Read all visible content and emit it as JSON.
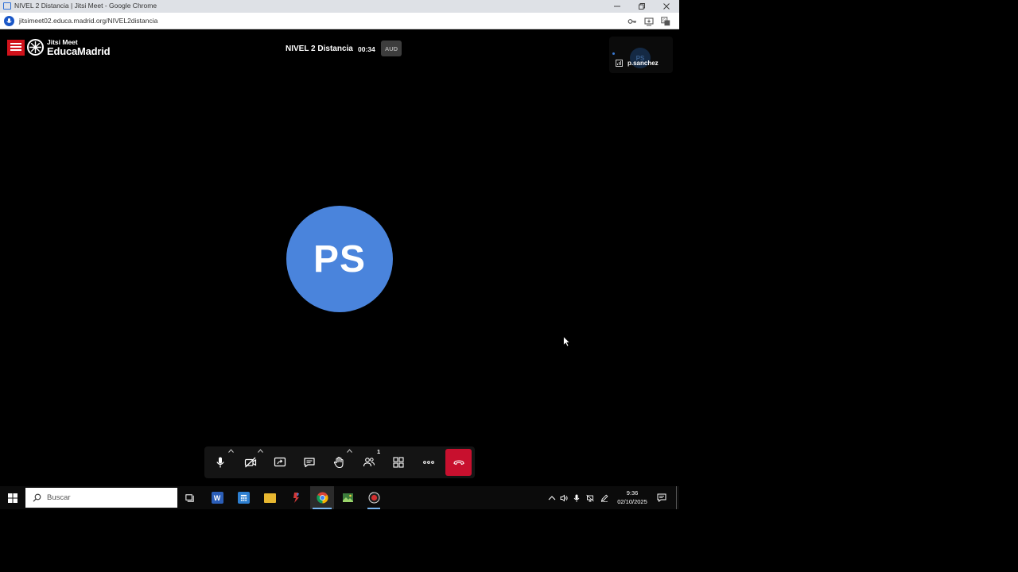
{
  "browser": {
    "tab_title": "NIVEL 2 Distancia | Jitsi Meet - Google Chrome",
    "url": "jitsimeet02.educa.madrid.org/NIVEL2distancia"
  },
  "meeting": {
    "logo_small": "Jitsi Meet",
    "logo_big": "EducaMadrid",
    "title": "NIVEL 2 Distancia",
    "timer": "00:34",
    "badge": "AUD",
    "participant_initials": "PS",
    "thumbnail_name": "p.sanchez",
    "participants_count": "1"
  },
  "toolbar": {
    "buttons": [
      "microphone",
      "camera",
      "screen-share",
      "chat",
      "raise-hand",
      "participants",
      "tile-view",
      "more",
      "leave"
    ]
  },
  "taskbar": {
    "search_placeholder": "Buscar",
    "time": "9:36",
    "date": "02/10/2025",
    "apps": [
      "task-view",
      "word",
      "calculator",
      "file-explorer",
      "app",
      "chrome",
      "app",
      "app"
    ]
  },
  "colors": {
    "avatar": "#4a84dc",
    "hangup": "#c8102e",
    "brand_red": "#d0121b",
    "taskbar_accent": "#78b5f0"
  }
}
